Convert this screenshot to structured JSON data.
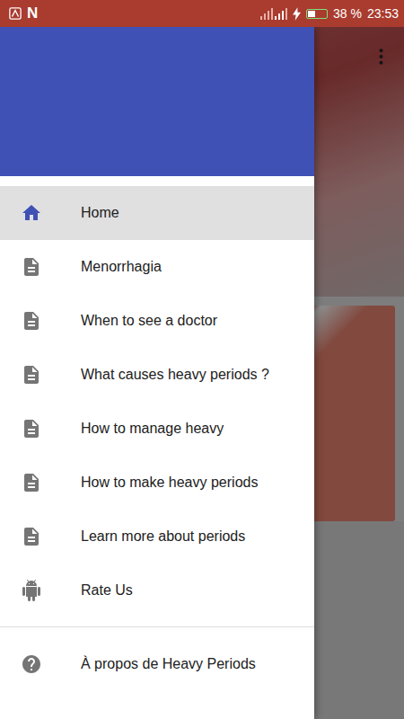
{
  "status_bar": {
    "notification_text": "N",
    "battery": {
      "level": 0.38,
      "charging": true
    },
    "battery_text": "38 %",
    "time": "23:53"
  },
  "drawer": {
    "items": [
      {
        "label": "Home",
        "kind": "home",
        "selected": true
      },
      {
        "label": "Menorrhagia",
        "kind": "page",
        "selected": false
      },
      {
        "label": "When to see a doctor",
        "kind": "page",
        "selected": false
      },
      {
        "label": "What causes heavy periods ?",
        "kind": "page",
        "selected": false
      },
      {
        "label": "How to manage heavy",
        "kind": "page",
        "selected": false
      },
      {
        "label": "How to make heavy periods",
        "kind": "page",
        "selected": false
      },
      {
        "label": "Learn more about periods",
        "kind": "page",
        "selected": false
      },
      {
        "label": "Rate Us",
        "kind": "android",
        "selected": false
      }
    ],
    "footer_items": [
      {
        "label": "À propos de Heavy Periods",
        "kind": "help",
        "selected": false
      }
    ]
  }
}
